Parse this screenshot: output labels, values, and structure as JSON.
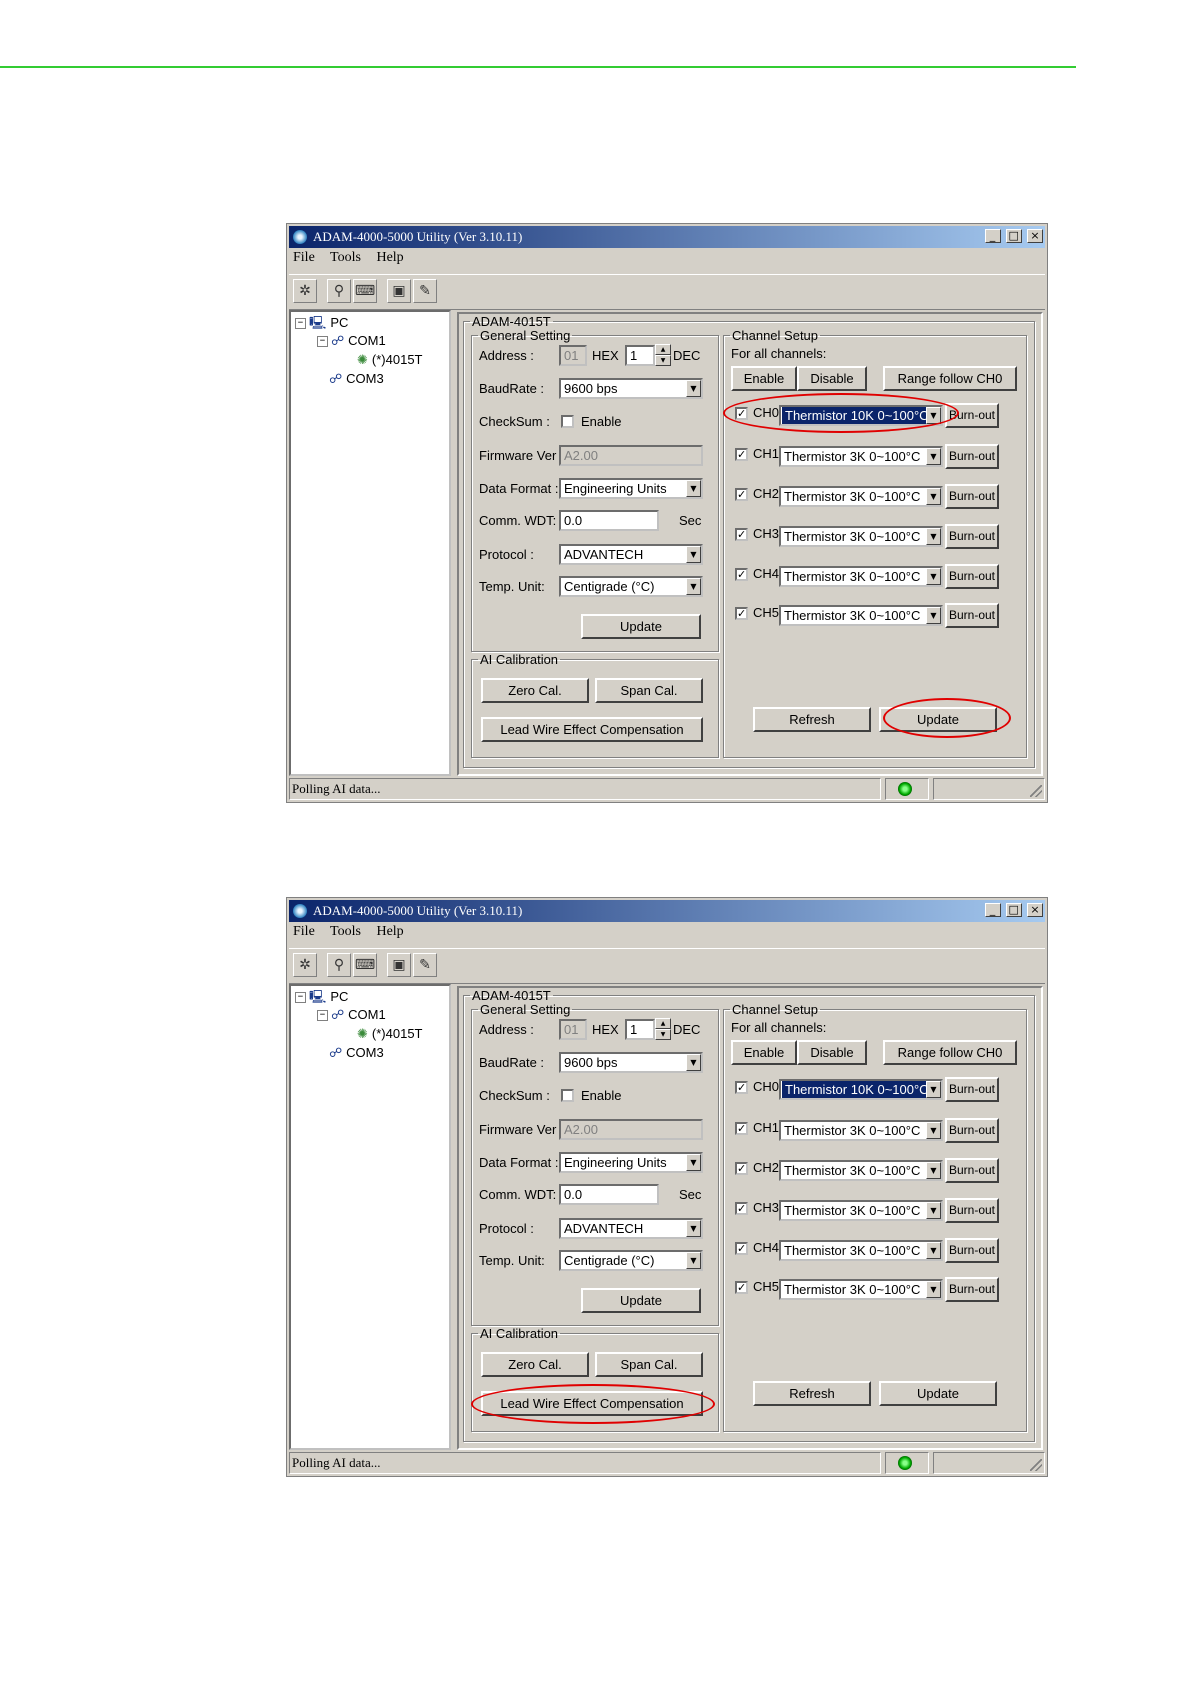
{
  "screens": [
    {
      "title": "ADAM-4000-5000 Utility (Ver 3.10.11)",
      "window_buttons": [
        "_",
        "□",
        "×"
      ],
      "menu": [
        "File",
        "Tools",
        "Help"
      ],
      "tree": {
        "root": "PC",
        "com1": "COM1",
        "module": "(*)4015T",
        "com3": "COM3"
      },
      "module_title": "ADAM-4015T",
      "general": {
        "legend": "General Setting",
        "address_label": "Address :",
        "address_hex": "01",
        "hex_label": "HEX",
        "address_dec": "1",
        "dec_label": "DEC",
        "baud_label": "BaudRate :",
        "baud_value": "9600 bps",
        "checksum_label": "CheckSum :",
        "checksum_enable": "Enable",
        "firmware_label": "Firmware Ver :",
        "firmware_value": "A2.00",
        "format_label": "Data Format :",
        "format_value": "Engineering Units",
        "wdt_label": "Comm. WDT:",
        "wdt_value": "0.0",
        "wdt_unit": "Sec",
        "protocol_label": "Protocol :",
        "protocol_value": "ADVANTECH",
        "temp_label": "Temp. Unit:",
        "temp_value": "Centigrade (°C)",
        "update": "Update"
      },
      "calibration": {
        "legend": "AI Calibration",
        "zero": "Zero Cal.",
        "span": "Span Cal.",
        "lead": "Lead Wire Effect Compensation"
      },
      "channels": {
        "legend": "Channel Setup",
        "all_label": "For all channels:",
        "enable": "Enable",
        "disable": "Disable",
        "range_follow": "Range follow CH0",
        "items": [
          {
            "name": "CH0",
            "range": "Thermistor 10K 0~100°C",
            "burnout": "Burn-out"
          },
          {
            "name": "CH1",
            "range": "Thermistor 3K 0~100°C",
            "burnout": "Burn-out"
          },
          {
            "name": "CH2",
            "range": "Thermistor 3K 0~100°C",
            "burnout": "Burn-out"
          },
          {
            "name": "CH3",
            "range": "Thermistor 3K 0~100°C",
            "burnout": "Burn-out"
          },
          {
            "name": "CH4",
            "range": "Thermistor 3K 0~100°C",
            "burnout": "Burn-out"
          },
          {
            "name": "CH5",
            "range": "Thermistor 3K 0~100°C",
            "burnout": "Burn-out"
          }
        ],
        "refresh": "Refresh",
        "update": "Update"
      },
      "status": "Polling AI data..."
    },
    {
      "title": "ADAM-4000-5000 Utility (Ver 3.10.11)",
      "window_buttons": [
        "_",
        "□",
        "×"
      ],
      "menu": [
        "File",
        "Tools",
        "Help"
      ],
      "tree": {
        "root": "PC",
        "com1": "COM1",
        "module": "(*)4015T",
        "com3": "COM3"
      },
      "module_title": "ADAM-4015T",
      "general": {
        "legend": "General Setting",
        "address_label": "Address :",
        "address_hex": "01",
        "hex_label": "HEX",
        "address_dec": "1",
        "dec_label": "DEC",
        "baud_label": "BaudRate :",
        "baud_value": "9600 bps",
        "checksum_label": "CheckSum :",
        "checksum_enable": "Enable",
        "firmware_label": "Firmware Ver :",
        "firmware_value": "A2.00",
        "format_label": "Data Format :",
        "format_value": "Engineering Units",
        "wdt_label": "Comm. WDT:",
        "wdt_value": "0.0",
        "wdt_unit": "Sec",
        "protocol_label": "Protocol :",
        "protocol_value": "ADVANTECH",
        "temp_label": "Temp. Unit:",
        "temp_value": "Centigrade (°C)",
        "update": "Update"
      },
      "calibration": {
        "legend": "AI Calibration",
        "zero": "Zero Cal.",
        "span": "Span Cal.",
        "lead": "Lead Wire Effect Compensation"
      },
      "channels": {
        "legend": "Channel Setup",
        "all_label": "For all channels:",
        "enable": "Enable",
        "disable": "Disable",
        "range_follow": "Range follow CH0",
        "items": [
          {
            "name": "CH0",
            "range": "Thermistor 10K 0~100°C",
            "burnout": "Burn-out"
          },
          {
            "name": "CH1",
            "range": "Thermistor 3K 0~100°C",
            "burnout": "Burn-out"
          },
          {
            "name": "CH2",
            "range": "Thermistor 3K 0~100°C",
            "burnout": "Burn-out"
          },
          {
            "name": "CH3",
            "range": "Thermistor 3K 0~100°C",
            "burnout": "Burn-out"
          },
          {
            "name": "CH4",
            "range": "Thermistor 3K 0~100°C",
            "burnout": "Burn-out"
          },
          {
            "name": "CH5",
            "range": "Thermistor 3K 0~100°C",
            "burnout": "Burn-out"
          }
        ],
        "refresh": "Refresh",
        "update": "Update"
      },
      "status": "Polling AI data..."
    }
  ],
  "colors": {
    "accent_line": "#33cc33",
    "annotation_oval": "#e00000",
    "selection": "#0a246a"
  }
}
